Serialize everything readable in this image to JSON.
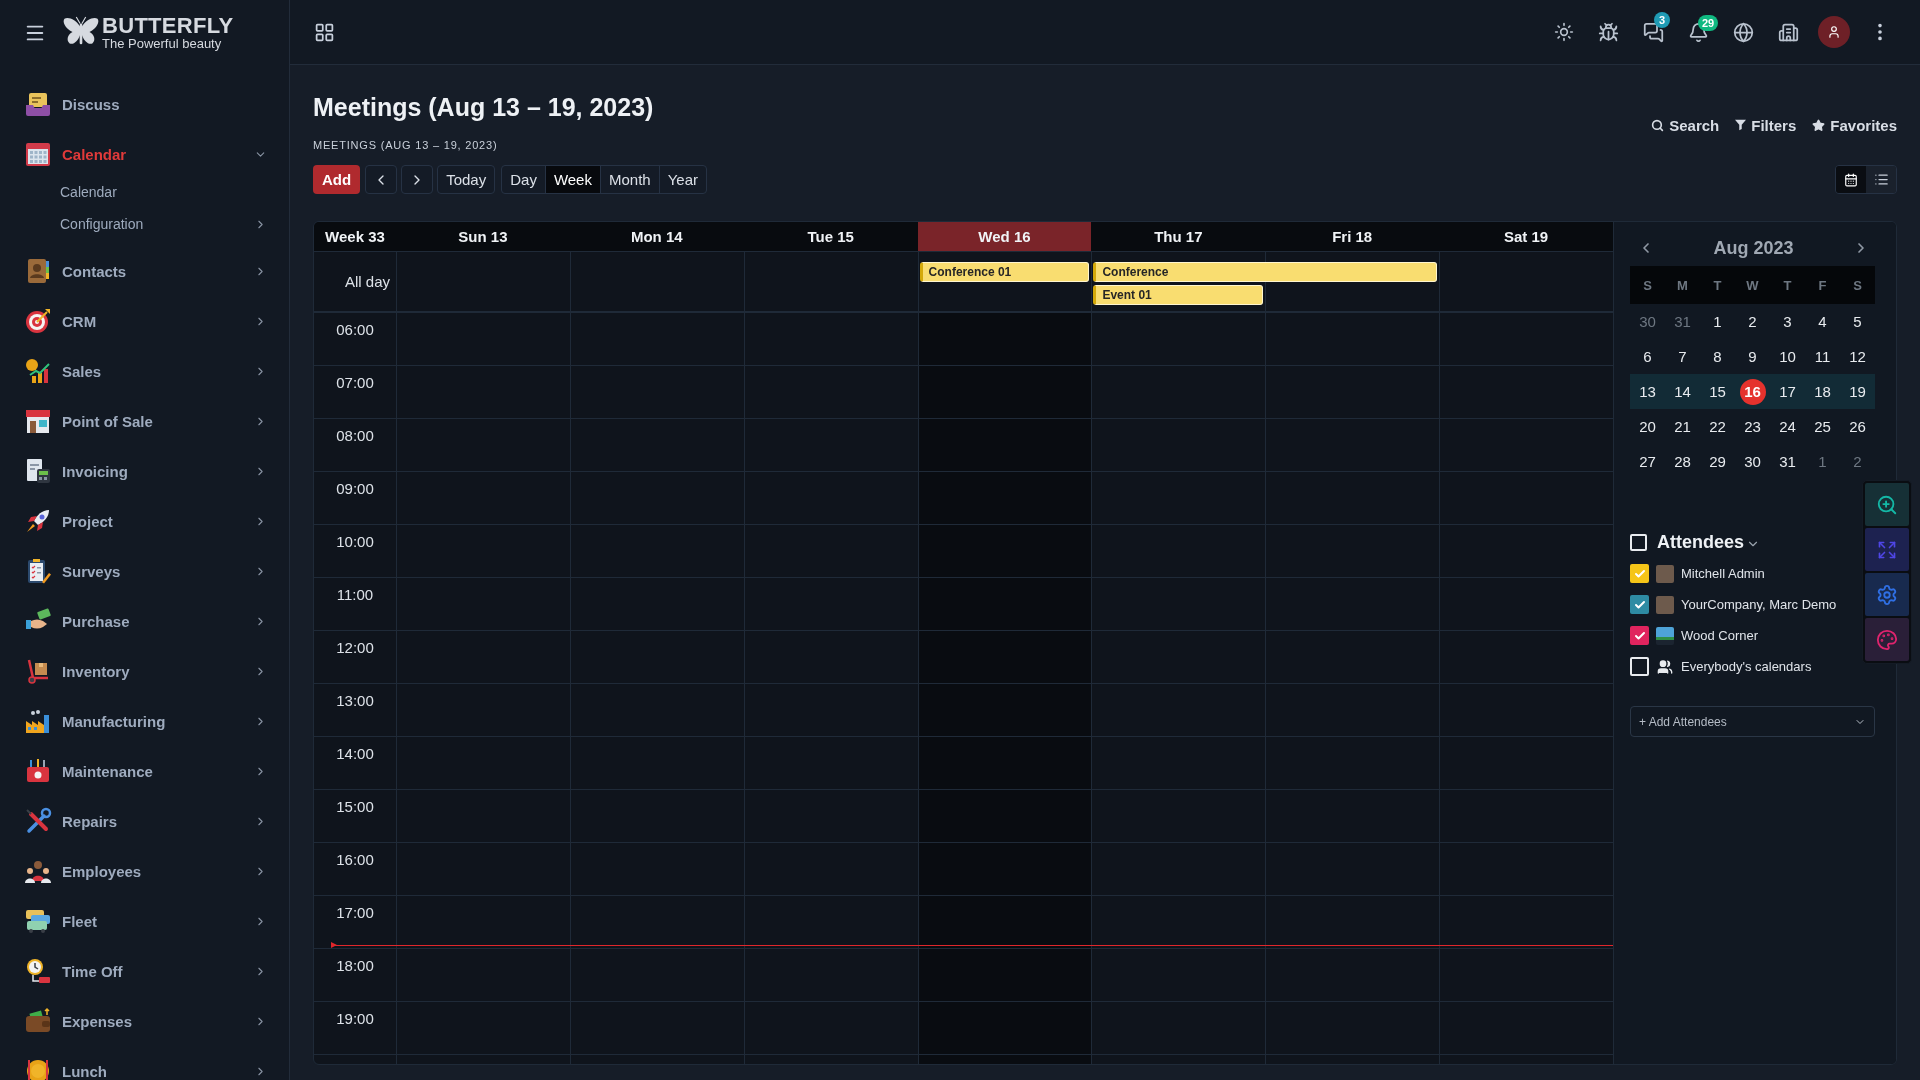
{
  "topbar": {
    "message_count": "3",
    "notification_count": "29"
  },
  "sidebar": {
    "brand": {
      "name": "BUTTERFLY",
      "tagline": "The Powerful beauty"
    },
    "items": [
      {
        "label": "Discuss",
        "selected": false,
        "submenu": false,
        "expanded": false
      },
      {
        "label": "Calendar",
        "selected": true,
        "submenu": true,
        "expanded": true,
        "children": [
          {
            "label": "Calendar",
            "submenu": false
          },
          {
            "label": "Configuration",
            "submenu": true
          }
        ]
      },
      {
        "label": "Contacts",
        "selected": false,
        "submenu": true,
        "expanded": false
      },
      {
        "label": "CRM",
        "selected": false,
        "submenu": true,
        "expanded": false
      },
      {
        "label": "Sales",
        "selected": false,
        "submenu": true,
        "expanded": false
      },
      {
        "label": "Point of Sale",
        "selected": false,
        "submenu": true,
        "expanded": false
      },
      {
        "label": "Invoicing",
        "selected": false,
        "submenu": true,
        "expanded": false
      },
      {
        "label": "Project",
        "selected": false,
        "submenu": true,
        "expanded": false
      },
      {
        "label": "Surveys",
        "selected": false,
        "submenu": true,
        "expanded": false
      },
      {
        "label": "Purchase",
        "selected": false,
        "submenu": true,
        "expanded": false
      },
      {
        "label": "Inventory",
        "selected": false,
        "submenu": true,
        "expanded": false
      },
      {
        "label": "Manufacturing",
        "selected": false,
        "submenu": true,
        "expanded": false
      },
      {
        "label": "Maintenance",
        "selected": false,
        "submenu": true,
        "expanded": false
      },
      {
        "label": "Repairs",
        "selected": false,
        "submenu": true,
        "expanded": false
      },
      {
        "label": "Employees",
        "selected": false,
        "submenu": true,
        "expanded": false
      },
      {
        "label": "Fleet",
        "selected": false,
        "submenu": true,
        "expanded": false
      },
      {
        "label": "Time Off",
        "selected": false,
        "submenu": true,
        "expanded": false
      },
      {
        "label": "Expenses",
        "selected": false,
        "submenu": true,
        "expanded": false
      },
      {
        "label": "Lunch",
        "selected": false,
        "submenu": true,
        "expanded": false
      }
    ]
  },
  "control_panel": {
    "title": "Meetings (Aug 13 – 19, 2023)",
    "breadcrumb": "MEETINGS (AUG 13 – 19, 2023)",
    "add": "Add",
    "today": "Today",
    "scales": [
      {
        "label": "Day",
        "selected": false
      },
      {
        "label": "Week",
        "selected": true
      },
      {
        "label": "Month",
        "selected": false
      },
      {
        "label": "Year",
        "selected": false
      }
    ],
    "search_actions": [
      {
        "label": "Search"
      },
      {
        "label": "Filters"
      },
      {
        "label": "Favorites"
      }
    ],
    "views": [
      {
        "kind": "calendar",
        "selected": true
      },
      {
        "kind": "list",
        "selected": false
      }
    ]
  },
  "week": {
    "week_label": "Week 33",
    "all_day_label": "All day",
    "days": [
      {
        "label": "Sun 13",
        "today": false
      },
      {
        "label": "Mon 14",
        "today": false
      },
      {
        "label": "Tue 15",
        "today": false
      },
      {
        "label": "Wed 16",
        "today": true,
        "all_day_events": [
          {
            "title": "Conference 01",
            "continues": false
          }
        ]
      },
      {
        "label": "Thu 17",
        "today": false,
        "all_day_events": [
          {
            "title": "Conference",
            "continues": true
          },
          {
            "title": "Event 01",
            "continues": false
          }
        ]
      },
      {
        "label": "Fri 18",
        "today": false
      },
      {
        "label": "Sat 19",
        "today": false
      }
    ],
    "hours": [
      {
        "label": "06:00",
        "current": false
      },
      {
        "label": "07:00",
        "current": false
      },
      {
        "label": "08:00",
        "current": false
      },
      {
        "label": "09:00",
        "current": false
      },
      {
        "label": "10:00",
        "current": false
      },
      {
        "label": "11:00",
        "current": false
      },
      {
        "label": "12:00",
        "current": false
      },
      {
        "label": "13:00",
        "current": false
      },
      {
        "label": "14:00",
        "current": false
      },
      {
        "label": "15:00",
        "current": false
      },
      {
        "label": "16:00",
        "current": false
      },
      {
        "label": "17:00",
        "current": true
      },
      {
        "label": "18:00",
        "current": false
      },
      {
        "label": "19:00",
        "current": false
      }
    ]
  },
  "side_panel": {
    "mini_calendar": {
      "title": "Aug 2023",
      "weekdays": [
        "S",
        "M",
        "T",
        "W",
        "T",
        "F",
        "S"
      ],
      "weeks": [
        {
          "selected": false,
          "days": [
            {
              "label": "30",
              "outside": true,
              "today": false
            },
            {
              "label": "31",
              "outside": true,
              "today": false
            },
            {
              "label": "1",
              "outside": false,
              "today": false
            },
            {
              "label": "2",
              "outside": false,
              "today": false
            },
            {
              "label": "3",
              "outside": false,
              "today": false
            },
            {
              "label": "4",
              "outside": false,
              "today": false
            },
            {
              "label": "5",
              "outside": false,
              "today": false
            }
          ]
        },
        {
          "selected": false,
          "days": [
            {
              "label": "6",
              "outside": false,
              "today": false
            },
            {
              "label": "7",
              "outside": false,
              "today": false
            },
            {
              "label": "8",
              "outside": false,
              "today": false
            },
            {
              "label": "9",
              "outside": false,
              "today": false
            },
            {
              "label": "10",
              "outside": false,
              "today": false
            },
            {
              "label": "11",
              "outside": false,
              "today": false
            },
            {
              "label": "12",
              "outside": false,
              "today": false
            }
          ]
        },
        {
          "selected": true,
          "days": [
            {
              "label": "13",
              "outside": false,
              "today": false
            },
            {
              "label": "14",
              "outside": false,
              "today": false
            },
            {
              "label": "15",
              "outside": false,
              "today": false
            },
            {
              "label": "16",
              "outside": false,
              "today": true
            },
            {
              "label": "17",
              "outside": false,
              "today": false
            },
            {
              "label": "18",
              "outside": false,
              "today": false
            },
            {
              "label": "19",
              "outside": false,
              "today": false
            }
          ]
        },
        {
          "selected": false,
          "days": [
            {
              "label": "20",
              "outside": false,
              "today": false
            },
            {
              "label": "21",
              "outside": false,
              "today": false
            },
            {
              "label": "22",
              "outside": false,
              "today": false
            },
            {
              "label": "23",
              "outside": false,
              "today": false
            },
            {
              "label": "24",
              "outside": false,
              "today": false
            },
            {
              "label": "25",
              "outside": false,
              "today": false
            },
            {
              "label": "26",
              "outside": false,
              "today": false
            }
          ]
        },
        {
          "selected": false,
          "days": [
            {
              "label": "27",
              "outside": false,
              "today": false
            },
            {
              "label": "28",
              "outside": false,
              "today": false
            },
            {
              "label": "29",
              "outside": false,
              "today": false
            },
            {
              "label": "30",
              "outside": false,
              "today": false
            },
            {
              "label": "31",
              "outside": false,
              "today": false
            },
            {
              "label": "1",
              "outside": true,
              "today": false
            },
            {
              "label": "2",
              "outside": true,
              "today": false
            }
          ]
        }
      ]
    },
    "attendees": {
      "title": "Attendees",
      "checked": false,
      "items": [
        {
          "name": "Mitchell Admin",
          "kind": "person",
          "checked": true,
          "color": "#f5c518"
        },
        {
          "name": "YourCompany, Marc Demo",
          "kind": "person",
          "checked": true,
          "color": "#2e8ba3"
        },
        {
          "name": "Wood Corner",
          "kind": "company",
          "checked": true,
          "color": "#e0245e"
        },
        {
          "name": "Everybody's calendars",
          "kind": "group",
          "checked": false
        }
      ],
      "add_placeholder": "+ Add Attendees"
    }
  }
}
